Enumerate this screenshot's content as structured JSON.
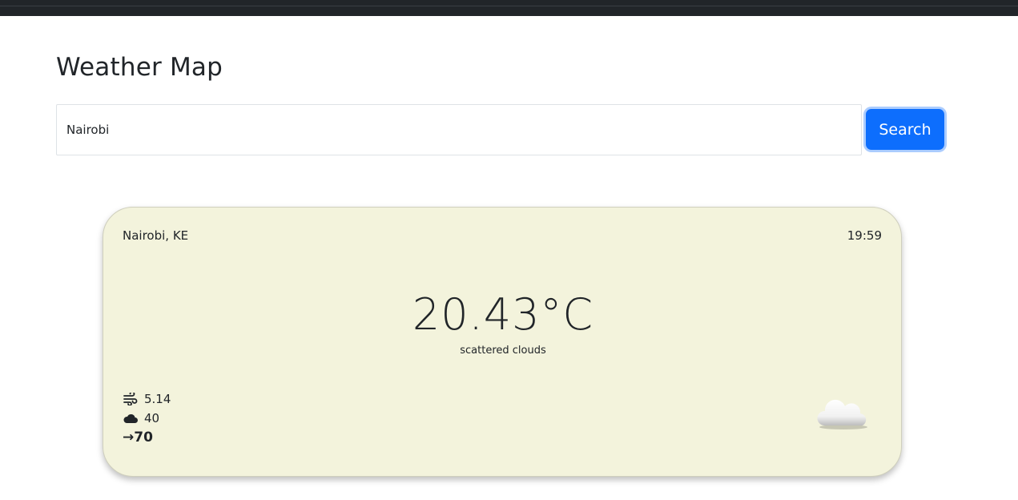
{
  "page": {
    "title": "Weather Map"
  },
  "search": {
    "value": "Nairobi",
    "button_label": "Search"
  },
  "weather": {
    "location": "Nairobi, KE",
    "time": "19:59",
    "temperature": "20.43°C",
    "description": "scattered clouds",
    "wind_speed": "5.14",
    "cloudiness": "40",
    "wind_direction_arrow": "→",
    "wind_direction": "70",
    "icons": {
      "wind": "wind-icon",
      "cloud": "cloud-icon",
      "condition": "scattered-clouds-icon"
    }
  },
  "colors": {
    "topbar": "#212529",
    "card_background": "#f3f3dc",
    "accent": "#0d6efd"
  }
}
